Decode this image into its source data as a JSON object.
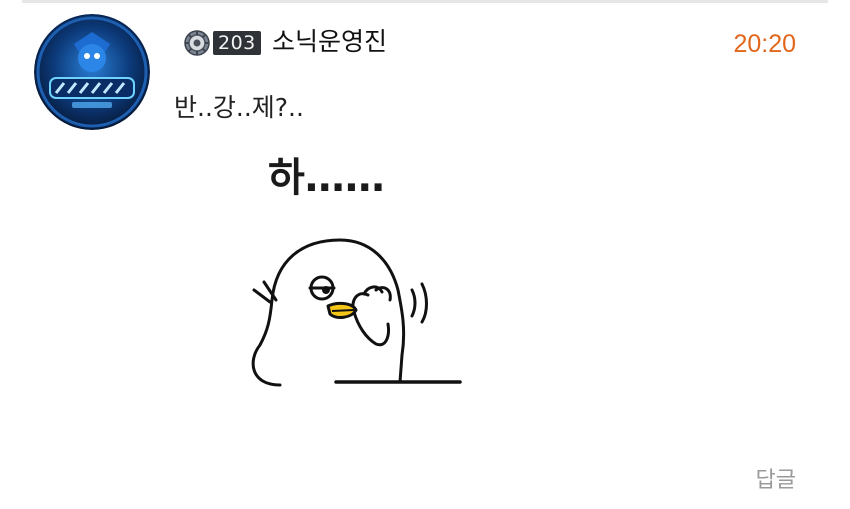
{
  "comment": {
    "author": {
      "level": "203",
      "nickname": "소닉운영진",
      "level_icon": "gear-medal-icon",
      "avatar_icon": "sonic-casino-logo"
    },
    "time": "20:20",
    "text": "반..강..제?..",
    "sticker": {
      "caption": "하……",
      "character": "white-bird-facepalm"
    },
    "reply_label": "답글"
  },
  "colors": {
    "timestamp": "#e2671d",
    "reply": "#9a9a9a",
    "level_badge_bg": "#2f3338",
    "beak": "#f5c518"
  }
}
